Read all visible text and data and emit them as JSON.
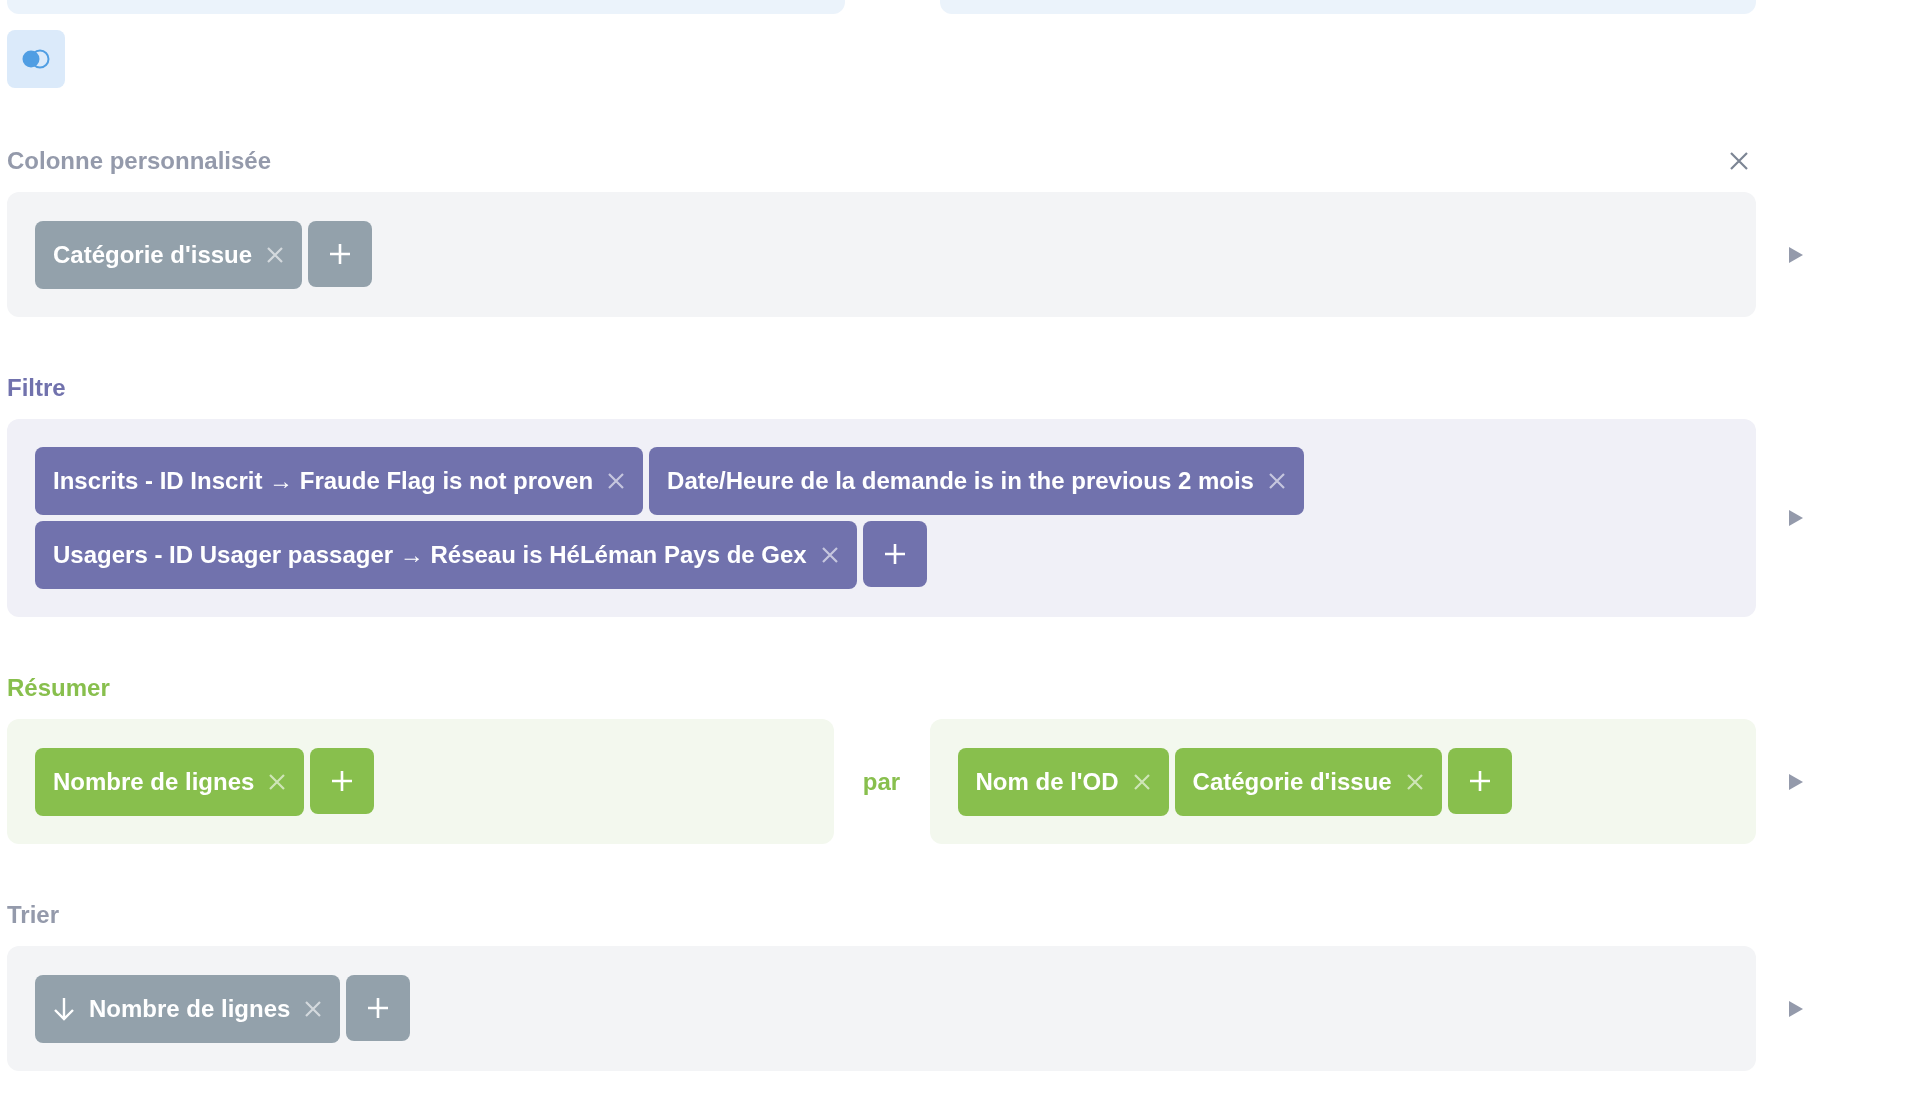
{
  "sections": [
    {
      "kind": "custom_column",
      "title": "Colonne personnalisée",
      "closable": true,
      "groups": [
        {
          "items": [
            {
              "label": "Catégorie d'issue"
            }
          ]
        }
      ]
    },
    {
      "kind": "filter",
      "title": "Filtre",
      "closable": false,
      "groups": [
        {
          "items": [
            {
              "label": "Inscrits - ID Inscrit → Fraude Flag is not proven"
            },
            {
              "label": "Date/Heure de la demande is in the previous 2 mois"
            },
            {
              "label": "Usagers - ID Usager passager → Réseau is HéLéman Pays de Gex"
            }
          ]
        }
      ]
    },
    {
      "kind": "summarize",
      "title": "Résumer",
      "closable": false,
      "joiner": "par",
      "groups": [
        {
          "items": [
            {
              "label": "Nombre de lignes"
            }
          ]
        },
        {
          "items": [
            {
              "label": "Nom de l'OD"
            },
            {
              "label": "Catégorie d'issue"
            }
          ]
        }
      ]
    },
    {
      "kind": "sort",
      "title": "Trier",
      "closable": false,
      "groups": [
        {
          "items": [
            {
              "label": "Nombre de lignes",
              "descending": true
            }
          ]
        }
      ]
    }
  ]
}
